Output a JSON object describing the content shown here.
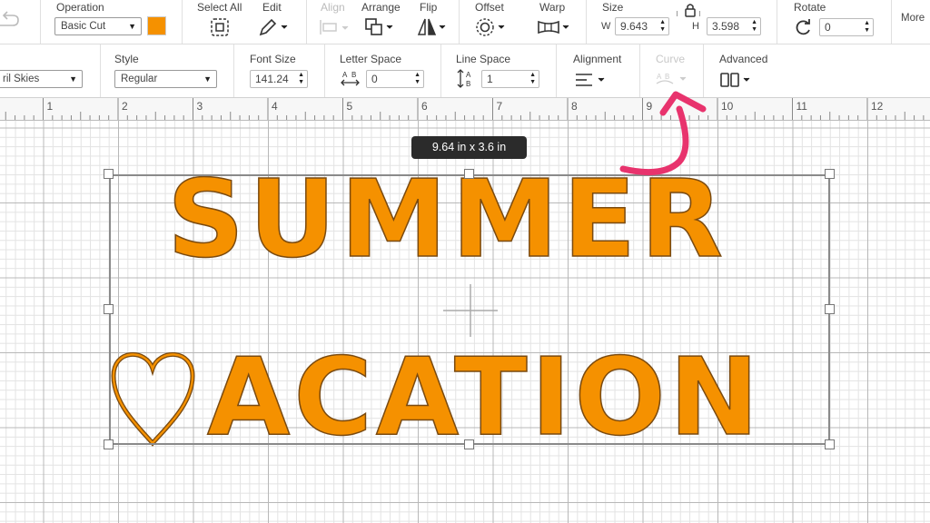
{
  "toolbar": {
    "undo_icon": "redo-arrow-icon",
    "operation": {
      "label": "Operation",
      "value": "Basic Cut",
      "color": "#f59100"
    },
    "select_all": {
      "label": "Select All"
    },
    "edit": {
      "label": "Edit"
    },
    "align": {
      "label": "Align",
      "disabled": true
    },
    "arrange": {
      "label": "Arrange"
    },
    "flip": {
      "label": "Flip"
    },
    "offset": {
      "label": "Offset"
    },
    "warp": {
      "label": "Warp"
    },
    "size": {
      "label": "Size",
      "w_label": "W",
      "w_value": "9.643",
      "h_label": "H",
      "h_value": "3.598",
      "locked": true
    },
    "rotate": {
      "label": "Rotate",
      "value": "0"
    },
    "more": {
      "label": "More"
    }
  },
  "text_toolbar": {
    "font": {
      "value": "ril Skies"
    },
    "style": {
      "label": "Style",
      "value": "Regular"
    },
    "font_size": {
      "label": "Font Size",
      "value": "141.24"
    },
    "letter_space": {
      "label": "Letter Space",
      "value": "0"
    },
    "line_space": {
      "label": "Line Space",
      "value": "1"
    },
    "alignment": {
      "label": "Alignment"
    },
    "curve": {
      "label": "Curve",
      "disabled": true
    },
    "advanced": {
      "label": "Advanced"
    }
  },
  "ruler": {
    "ticks": [
      "1",
      "2",
      "3",
      "4",
      "5",
      "6",
      "7",
      "8",
      "9",
      "10",
      "11",
      "12"
    ]
  },
  "canvas": {
    "size_tooltip": "9.64  in x 3.6  in",
    "line1": "SUMMER",
    "line2": "ACATION",
    "fill_color": "#f59100",
    "annotation_color": "#e8336d"
  }
}
